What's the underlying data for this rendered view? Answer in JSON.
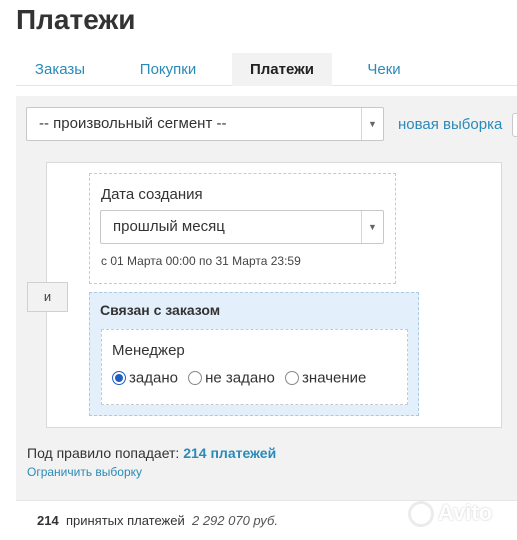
{
  "page": {
    "title": "Платежи"
  },
  "tabs": [
    {
      "label": "Заказы",
      "active": false
    },
    {
      "label": "Покупки",
      "active": false
    },
    {
      "label": "Платежи",
      "active": true
    },
    {
      "label": "Чеки",
      "active": false
    }
  ],
  "segment": {
    "selected": "-- произвольный сегмент --",
    "new_selection_link": "новая выборка"
  },
  "conditions": {
    "and_label": "и",
    "created_date": {
      "label": "Дата создания",
      "period": "прошлый месяц",
      "range_text": "с 01 Марта 00:00 по 31 Марта 23:59"
    },
    "linked_order": {
      "title": "Связан с заказом",
      "manager": {
        "label": "Менеджер",
        "options": [
          "задано",
          "не задано",
          "значение"
        ],
        "selected": "задано"
      }
    }
  },
  "summary": {
    "prefix": "Под правило попадает:",
    "count": "214 платежей",
    "limit_link": "Ограничить выборку"
  },
  "footer": {
    "count": "214",
    "label": "принятых платежей",
    "amount": "2 292 070 руб."
  },
  "watermark": {
    "text": "Avito"
  },
  "colors": {
    "link": "#2a8ab8",
    "radio_selected": "#1f5fbf",
    "group_bg": "#e3effb"
  }
}
